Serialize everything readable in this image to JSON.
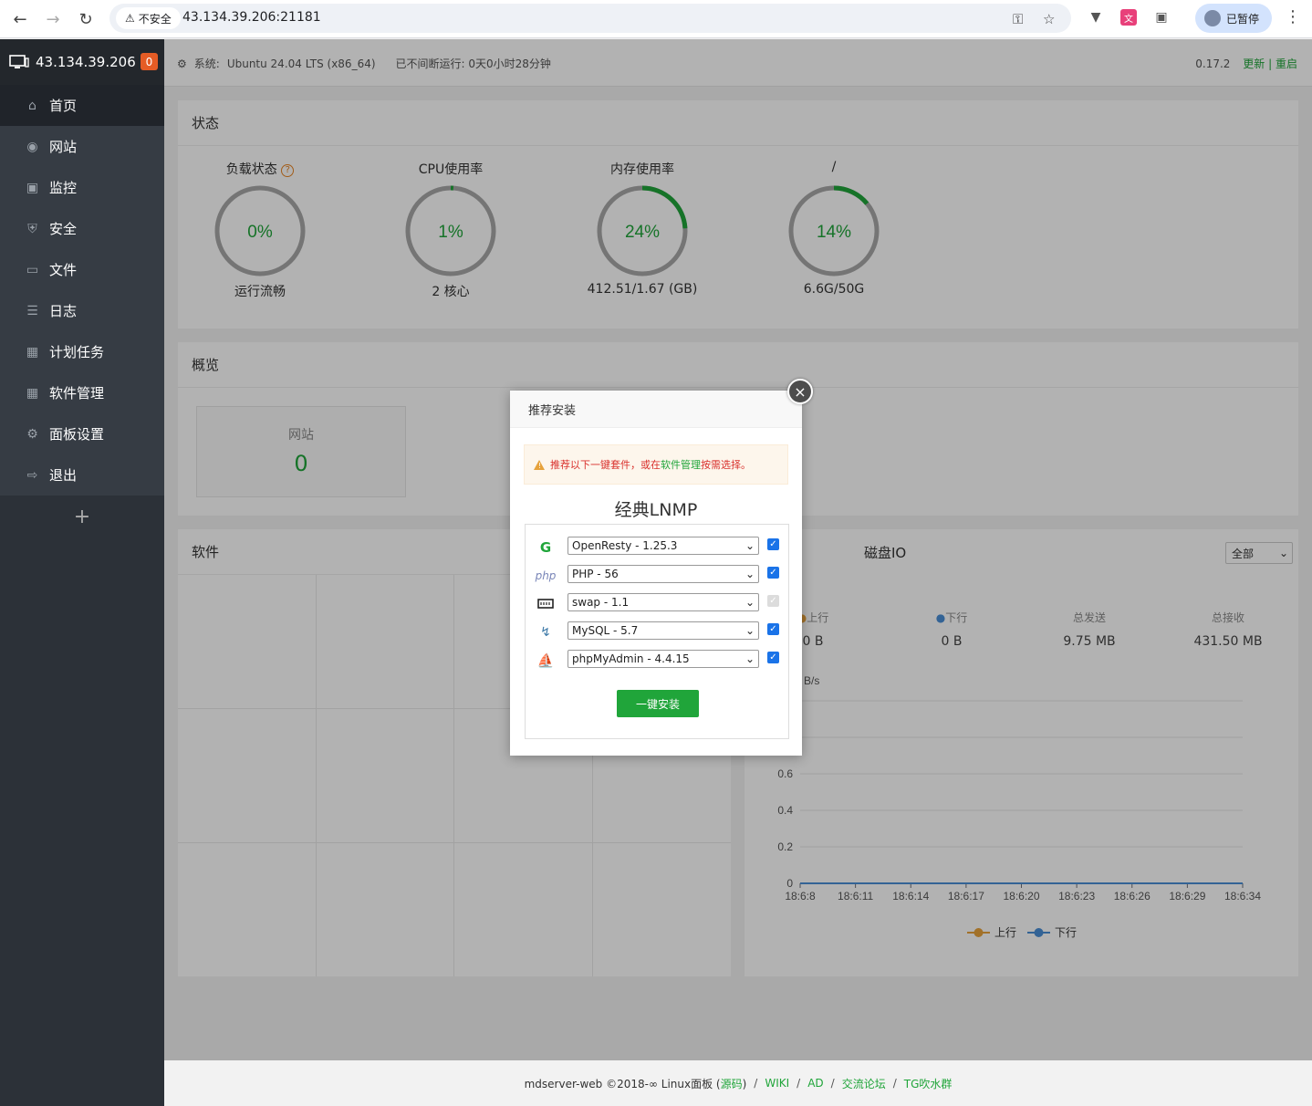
{
  "browser": {
    "insecure_label": "不安全",
    "url": "43.134.39.206:21181",
    "profile_label": "已暂停"
  },
  "sidebar": {
    "server_title": "43.134.39.206",
    "notify_count": "0",
    "items": [
      {
        "label": "首页",
        "icon": "home-icon"
      },
      {
        "label": "网站",
        "icon": "globe-icon"
      },
      {
        "label": "监控",
        "icon": "monitor-icon"
      },
      {
        "label": "安全",
        "icon": "shield-icon"
      },
      {
        "label": "文件",
        "icon": "folder-icon"
      },
      {
        "label": "日志",
        "icon": "log-icon"
      },
      {
        "label": "计划任务",
        "icon": "calendar-icon"
      },
      {
        "label": "软件管理",
        "icon": "grid-icon"
      },
      {
        "label": "面板设置",
        "icon": "gear-icon"
      },
      {
        "label": "退出",
        "icon": "logout-icon"
      }
    ],
    "add_label": "+"
  },
  "topbar": {
    "system_label": "系统:",
    "system_value": "Ubuntu 24.04 LTS (x86_64)",
    "uptime": "已不间断运行: 0天0小时28分钟",
    "version": "0.17.2",
    "update": "更新",
    "divider": "|",
    "restart": "重启"
  },
  "status": {
    "title": "状态",
    "gauges": [
      {
        "label": "负载状态",
        "value": "0%",
        "percent": 0,
        "sub": "运行流畅"
      },
      {
        "label": "CPU使用率",
        "value": "1%",
        "percent": 1,
        "sub": "2 核心"
      },
      {
        "label": "内存使用率",
        "value": "24%",
        "percent": 24,
        "sub": "412.51/1.67 (GB)"
      },
      {
        "label": "/",
        "value": "14%",
        "percent": 14,
        "sub": "6.6G/50G"
      }
    ],
    "help_mark": "?"
  },
  "overview": {
    "title": "概览",
    "site_label": "网站",
    "site_count": "0"
  },
  "software": {
    "title": "软件"
  },
  "io": {
    "title": "磁盘IO",
    "filter": "全部",
    "stats": [
      {
        "key": "上行",
        "value": "0 B"
      },
      {
        "key": "下行",
        "value": "0 B"
      },
      {
        "key": "总发送",
        "value": "9.75 MB"
      },
      {
        "key": "总接收",
        "value": "431.50 MB"
      }
    ],
    "unit": "B/s"
  },
  "chart_data": {
    "type": "line",
    "title": "",
    "xlabel": "",
    "ylabel": "B/s",
    "x": [
      "18:6:8",
      "18:6:11",
      "18:6:14",
      "18:6:17",
      "18:6:20",
      "18:6:23",
      "18:6:26",
      "18:6:29",
      "18:6:34"
    ],
    "y_ticks": [
      "0",
      "0.2",
      "0.4",
      "0.6"
    ],
    "ylim": [
      0,
      1
    ],
    "series": [
      {
        "name": "上行",
        "color": "#e8a33b",
        "values": [
          0,
          0,
          0,
          0,
          0,
          0,
          0,
          0,
          0
        ]
      },
      {
        "name": "下行",
        "color": "#4a8fd6",
        "values": [
          0,
          0,
          0,
          0,
          0,
          0,
          0,
          0,
          0
        ]
      }
    ],
    "legend": "bottom",
    "grid": true
  },
  "modal": {
    "title": "推荐安装",
    "alert_prefix": "推荐以下一键套件，或在",
    "alert_link": "软件管理",
    "alert_suffix": "按需选择。",
    "suite_title": "经典LNMP",
    "items": [
      {
        "icon": "openresty-icon",
        "value": "OpenResty - 1.25.3",
        "checked": true
      },
      {
        "icon": "php-icon",
        "value": "PHP - 56",
        "checked": true
      },
      {
        "icon": "swap-icon",
        "value": "swap - 1.1",
        "checked": true,
        "disabled": true
      },
      {
        "icon": "mysql-icon",
        "value": "MySQL - 5.7",
        "checked": true
      },
      {
        "icon": "phpmyadmin-icon",
        "value": "phpMyAdmin - 4.4.15",
        "checked": true
      }
    ],
    "install_label": "一键安装",
    "close": "×"
  },
  "footer": {
    "prefix": "mdserver-web ©2018-∞ Linux面板 (",
    "source": "源码",
    "close_paren": ")",
    "wiki": "WIKI",
    "ad": "AD",
    "forum": "交流论坛",
    "tg": "TG吹水群",
    "sep": "/"
  },
  "colors": {
    "accent": "#20a53a",
    "sidebar": "#2c3138",
    "alert_text": "#d9302c"
  }
}
